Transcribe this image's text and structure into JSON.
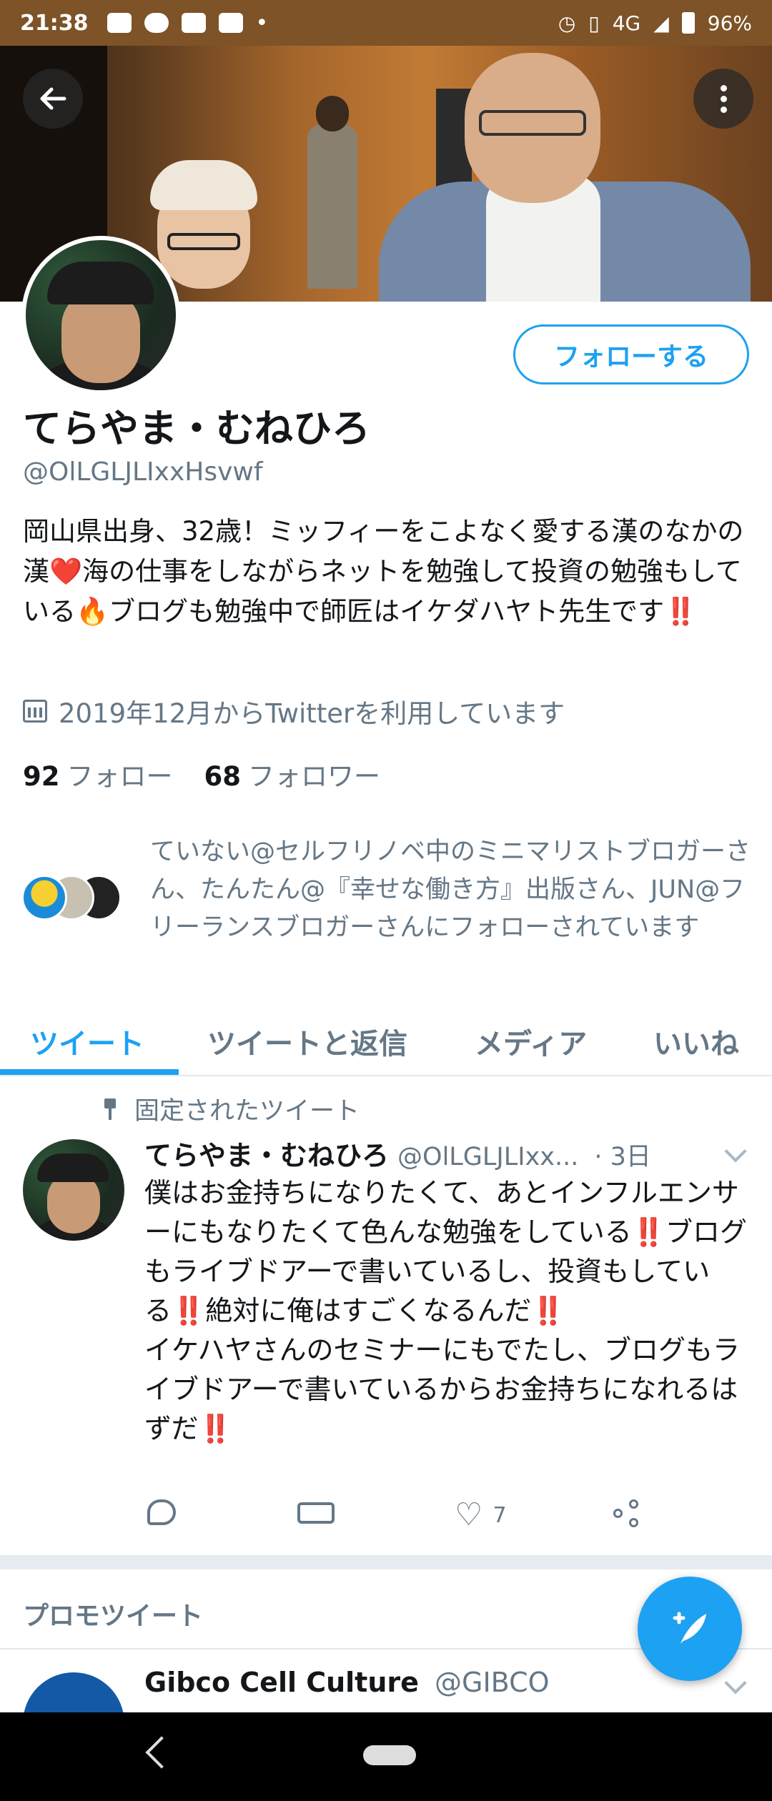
{
  "status_bar": {
    "time": "21:38",
    "network": "4G",
    "battery": "96%"
  },
  "profile": {
    "display_name": "てらやま・むねひろ",
    "handle": "@OlLGLJLIxxHsvwf",
    "follow_button": "フォローする",
    "bio": "岡山県出身、32歳！ミッフィーをこよなく愛する漢のなかの漢❤️海の仕事をしながらネットを勉強して投資の勉強もしている🔥ブログも勉強中で師匠はイケダハヤト先生です‼️",
    "joined": "2019年12月からTwitterを利用しています",
    "following_count": "92",
    "following_label": "フォロー",
    "followers_count": "68",
    "followers_label": "フォロワー",
    "followed_by": "ていない@セルフリノベ中のミニマリストブロガーさん、たんたん@『幸せな働き方』出版さん、JUN@フリーランスブロガーさんにフォローされています"
  },
  "tabs": [
    {
      "label": "ツイート",
      "active": true
    },
    {
      "label": "ツイートと返信",
      "active": false
    },
    {
      "label": "メディア",
      "active": false
    },
    {
      "label": "いいね",
      "active": false
    }
  ],
  "pinned_tweet": {
    "pinned_label": "固定されたツイート",
    "name": "てらやま・むねひろ",
    "handle": "@OlLGLJLIxx...",
    "time": "· 3日",
    "text": "僕はお金持ちになりたくて、あとインフルエンサーにもなりたくて色んな勉強をしている‼️ブログもライブドアーで書いているし、投資もしている‼️絶対に俺はすごくなるんだ‼️\nイケハヤさんのセミナーにもでたし、ブログもライブドアーで書いているからお金持ちになれるはずだ‼️",
    "like_count": "7"
  },
  "promo": {
    "label": "プロモツイート",
    "name": "Gibco Cell Culture",
    "handle": "@GIBCO"
  },
  "colors": {
    "accent": "#1da1f2",
    "secondary_text": "#657786",
    "status_bar": "#7d5327"
  },
  "icons": [
    "back-arrow-icon",
    "more-vertical-icon",
    "calendar-icon",
    "pin-icon",
    "reply-icon",
    "retweet-icon",
    "heart-icon",
    "share-icon",
    "compose-tweet-icon"
  ]
}
